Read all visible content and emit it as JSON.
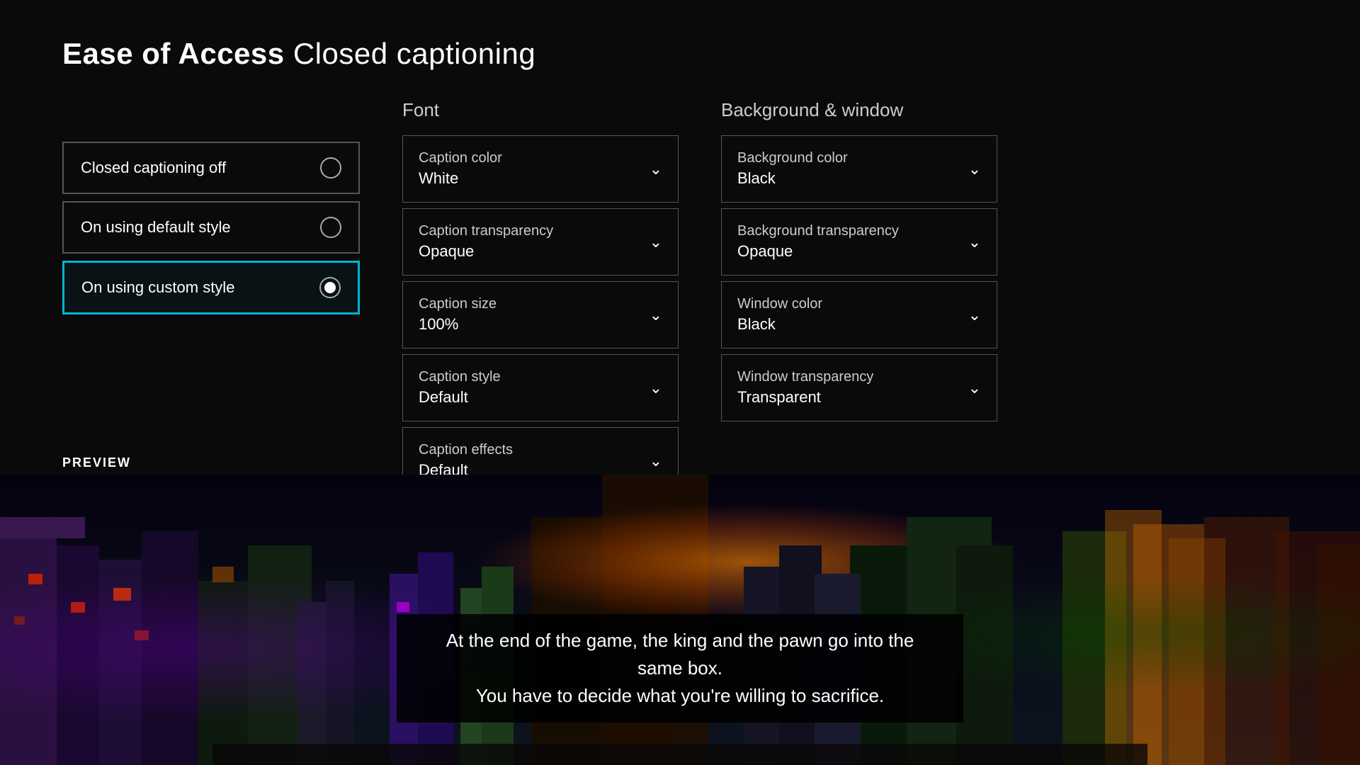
{
  "header": {
    "brand": "Ease of Access",
    "title": "Closed captioning"
  },
  "radio_options": [
    {
      "id": "off",
      "label": "Closed captioning off",
      "selected": false,
      "active": false
    },
    {
      "id": "default",
      "label": "On using default style",
      "selected": false,
      "active": false
    },
    {
      "id": "custom",
      "label": "On using custom style",
      "selected": true,
      "active": true
    }
  ],
  "font_section": {
    "header": "Font",
    "dropdowns": [
      {
        "id": "caption-color",
        "label": "Caption color",
        "value": "White"
      },
      {
        "id": "caption-transparency",
        "label": "Caption transparency",
        "value": "Opaque"
      },
      {
        "id": "caption-size",
        "label": "Caption size",
        "value": "100%"
      },
      {
        "id": "caption-style",
        "label": "Caption style",
        "value": "Default"
      },
      {
        "id": "caption-effects",
        "label": "Caption effects",
        "value": "Default"
      }
    ]
  },
  "bg_section": {
    "header": "Background & window",
    "dropdowns": [
      {
        "id": "background-color",
        "label": "Background color",
        "value": "Black"
      },
      {
        "id": "background-transparency",
        "label": "Background transparency",
        "value": "Opaque"
      },
      {
        "id": "window-color",
        "label": "Window color",
        "value": "Black"
      },
      {
        "id": "window-transparency",
        "label": "Window transparency",
        "value": "Transparent"
      }
    ]
  },
  "preview": {
    "label": "PREVIEW",
    "caption_line1": "At the end of the game, the king and the pawn go into the same box.",
    "caption_line2": "You have to decide what you're willing to sacrifice."
  },
  "colors": {
    "active_border": "#00b4d8",
    "bg": "#0a0a0a",
    "text": "#ffffff",
    "muted": "#cccccc",
    "border": "#555555"
  }
}
